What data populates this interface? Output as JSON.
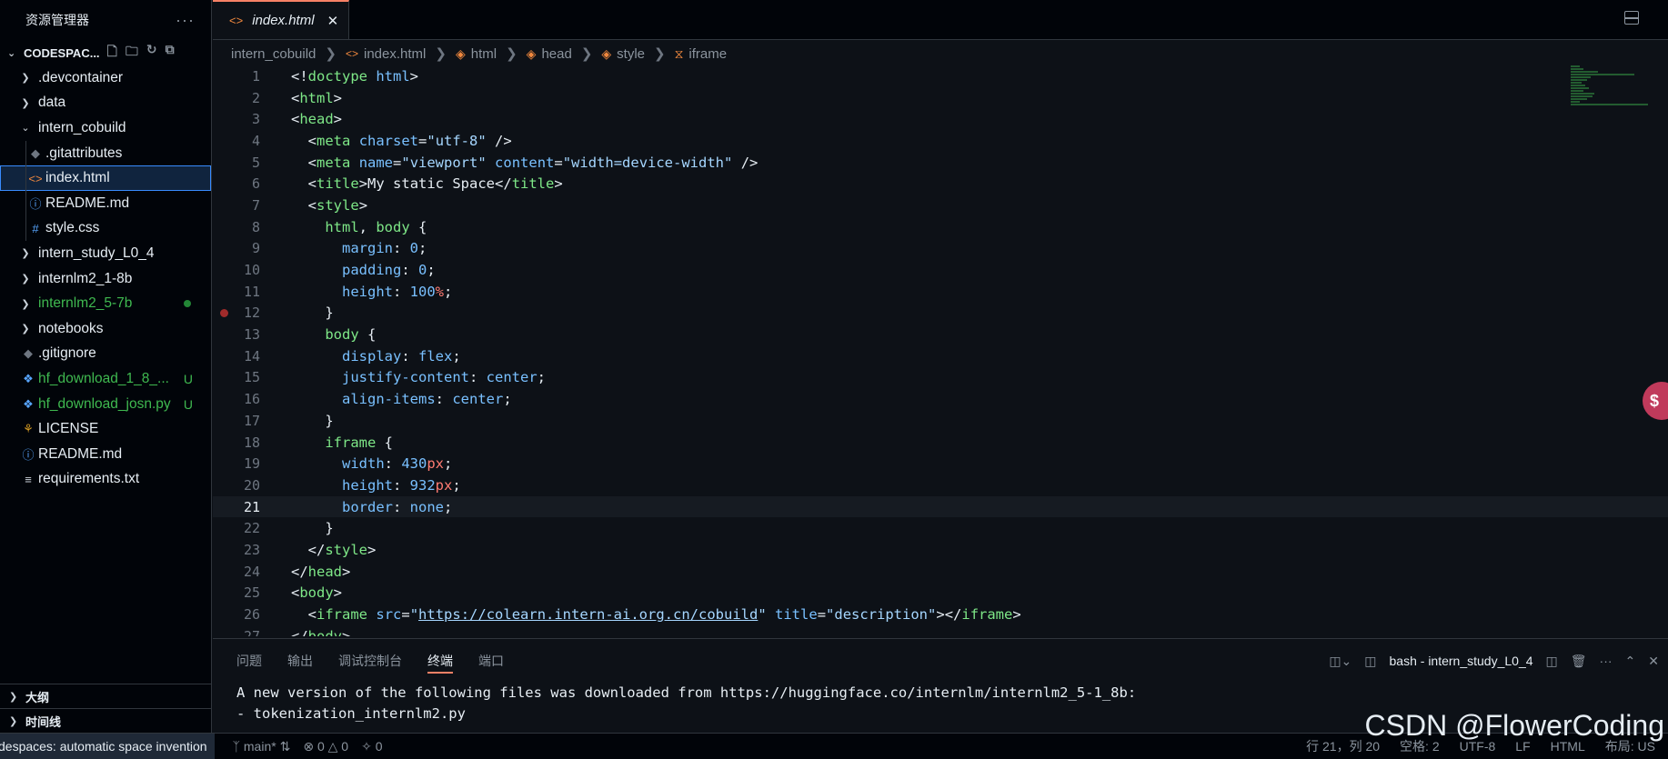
{
  "sidebar": {
    "title": "资源管理器",
    "more": "···",
    "root": "CODESPAC...",
    "items": [
      {
        "label": ".devcontainer",
        "type": "folder",
        "depth": 1,
        "state": "collapsed"
      },
      {
        "label": "data",
        "type": "folder",
        "depth": 1,
        "state": "collapsed"
      },
      {
        "label": "intern_cobuild",
        "type": "folder",
        "depth": 1,
        "state": "expanded"
      },
      {
        "label": ".gitattributes",
        "type": "file",
        "depth": 2,
        "icon": "git-icon"
      },
      {
        "label": "index.html",
        "type": "file",
        "depth": 2,
        "icon": "html-icon",
        "selected": true
      },
      {
        "label": "README.md",
        "type": "file",
        "depth": 2,
        "icon": "info-icon"
      },
      {
        "label": "style.css",
        "type": "file",
        "depth": 2,
        "icon": "hash-icon"
      },
      {
        "label": "intern_study_L0_4",
        "type": "folder",
        "depth": 1,
        "state": "collapsed"
      },
      {
        "label": "internlm2_1-8b",
        "type": "folder",
        "depth": 1,
        "state": "collapsed"
      },
      {
        "label": "internlm2_5-7b",
        "type": "folder",
        "depth": 1,
        "state": "collapsed",
        "modified": true
      },
      {
        "label": "notebooks",
        "type": "folder",
        "depth": 1,
        "state": "collapsed"
      },
      {
        "label": ".gitignore",
        "type": "file",
        "depth": 1,
        "icon": "git-icon"
      },
      {
        "label": "hf_download_1_8_...",
        "type": "file",
        "depth": 1,
        "icon": "python-icon",
        "badge": "U"
      },
      {
        "label": "hf_download_josn.py",
        "type": "file",
        "depth": 1,
        "icon": "python-icon",
        "badge": "U"
      },
      {
        "label": "LICENSE",
        "type": "file",
        "depth": 1,
        "icon": "license-icon"
      },
      {
        "label": "README.md",
        "type": "file",
        "depth": 1,
        "icon": "info-icon"
      },
      {
        "label": "requirements.txt",
        "type": "file",
        "depth": 1,
        "icon": "lines-icon"
      }
    ],
    "outline_label": "大纲",
    "timeline_label": "时间线"
  },
  "editor": {
    "tab_label": "index.html",
    "breadcrumb": [
      "intern_cobuild",
      "index.html",
      "html",
      "head",
      "style",
      "iframe"
    ],
    "active_line": 21,
    "breakpoint_line": 12
  },
  "panel": {
    "tabs": [
      "问题",
      "输出",
      "调试控制台",
      "终端",
      "端口"
    ],
    "active_tab": "终端",
    "terminal_name": "bash - intern_study_L0_4",
    "terminal_lines": [
      "A new version of the following files was downloaded from https://huggingface.co/internlm/internlm2_5-1_8b:",
      "- tokenization_internlm2.py"
    ]
  },
  "statusbar": {
    "remote": "despaces: automatic space invention",
    "branch": "main*",
    "errors": "0",
    "warnings": "0",
    "ports": "0",
    "position": "行 21，列 20",
    "spaces": "空格: 2",
    "encoding": "UTF-8",
    "eol": "LF",
    "language": "HTML",
    "layout": "布局: US"
  },
  "watermark": "CSDN @FlowerCoding",
  "colors": {
    "accent": "#f78166",
    "selection_border": "#388bfd",
    "untracked": "#3fb950"
  }
}
